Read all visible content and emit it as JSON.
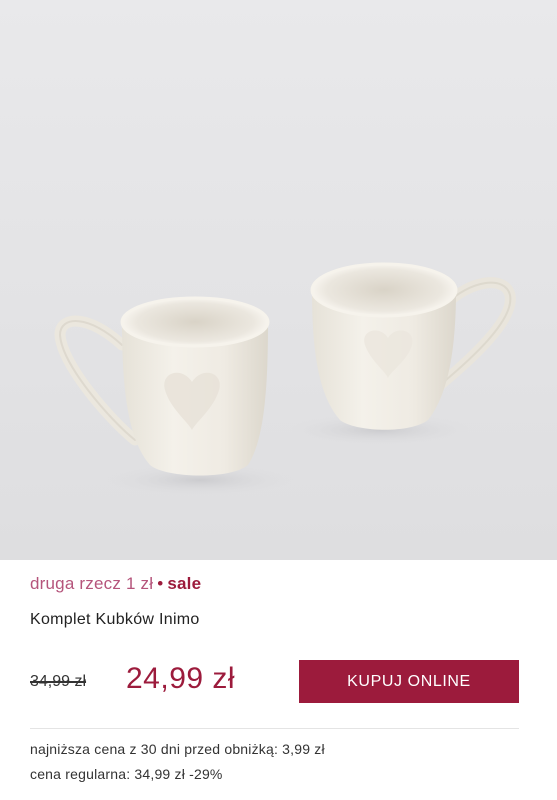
{
  "product": {
    "image_alt": "mug-pair-photo",
    "promo": {
      "offer": "druga rzecz 1 zł",
      "separator": "•",
      "sale": "sale"
    },
    "title": "Komplet Kubków Inimo",
    "old_price": "34,99 zł",
    "new_price": "24,99 zł",
    "buy_label": "KUPUJ ONLINE",
    "lowest_price_note": "najniższa cena z 30 dni przed obniżką: 3,99 zł",
    "regular_price_note": "cena regularna: 34,99 zł -29%"
  },
  "colors": {
    "accent": "#9c1b3c",
    "promo": "#b5547b"
  }
}
